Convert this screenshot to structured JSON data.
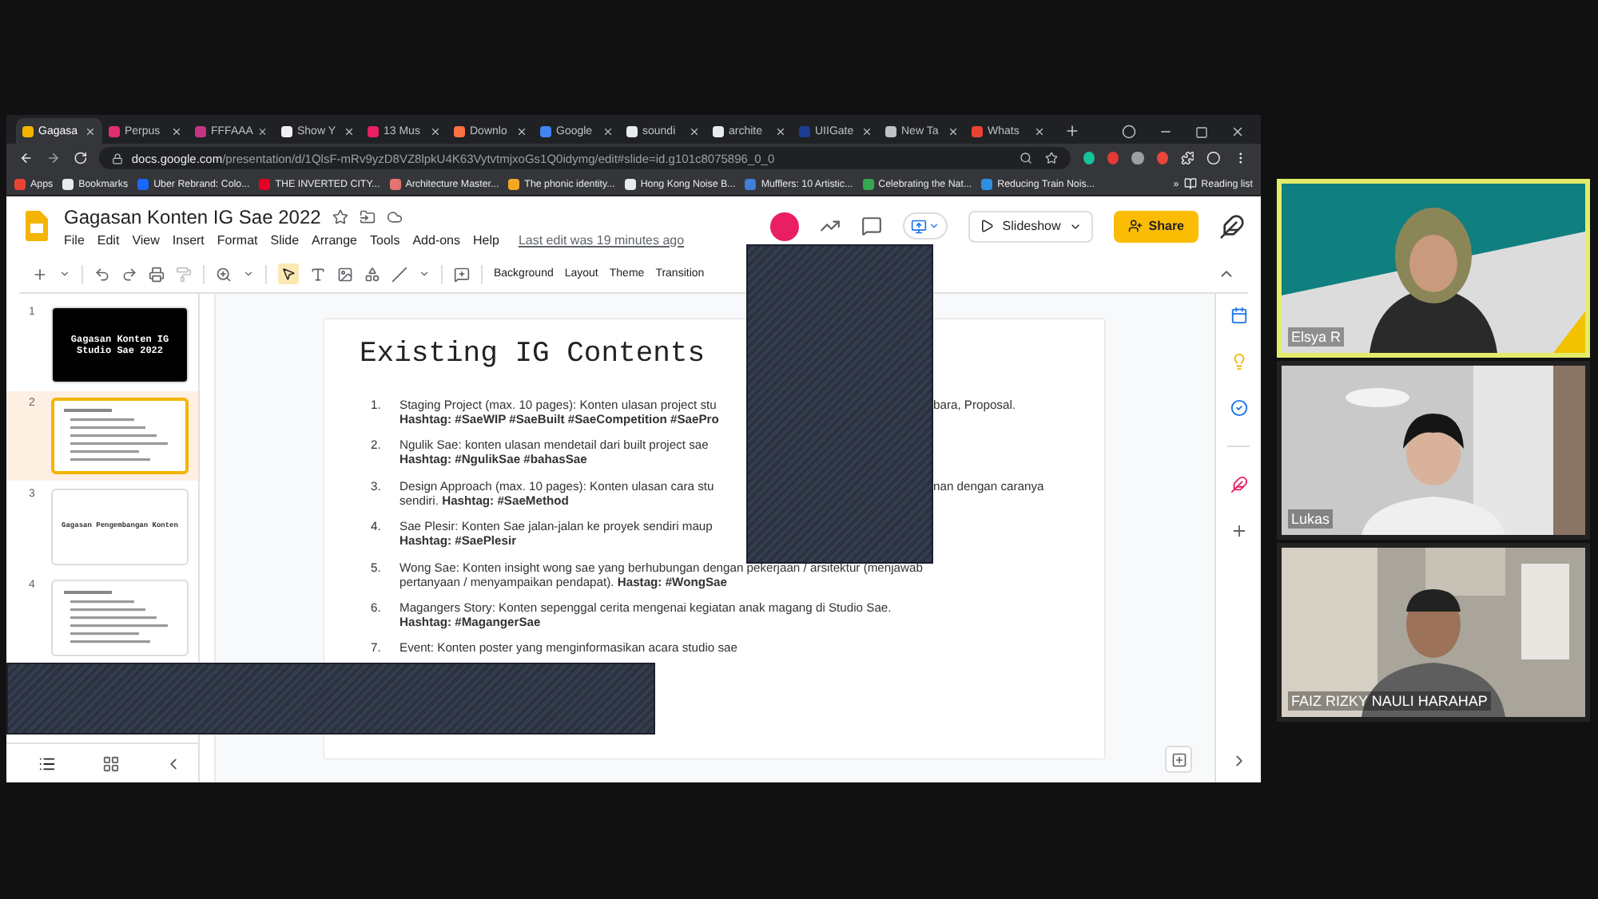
{
  "browser": {
    "tabs": [
      {
        "label": "Gagasa",
        "color": "#f4b400",
        "selected": true
      },
      {
        "label": "Perpus",
        "color": "#e1306c",
        "selected": false
      },
      {
        "label": "FFFAAA",
        "color": "#c13584",
        "selected": false
      },
      {
        "label": "Show Y",
        "color": "#f1f1f1",
        "selected": false
      },
      {
        "label": "13 Mus",
        "color": "#e91e63",
        "selected": false
      },
      {
        "label": "Downlo",
        "color": "#ff7043",
        "selected": false
      },
      {
        "label": "Google",
        "color": "#4285f4",
        "selected": false
      },
      {
        "label": "soundi",
        "color": "#e8eaed",
        "selected": false
      },
      {
        "label": "archite",
        "color": "#e8eaed",
        "selected": false
      },
      {
        "label": "UIIGate",
        "color": "#1a3d8f",
        "selected": false
      },
      {
        "label": "New Ta",
        "color": "#bdc1c6",
        "selected": false
      },
      {
        "label": "Whats",
        "color": "#ea4335",
        "selected": false
      }
    ],
    "url": {
      "host": "docs.google.com",
      "path": "/presentation/d/1QlsF-mRv9yzD8VZ8lpkU4K63VytvtmjxoGs1Q0idymg/edit#slide=id.g101c8075896_0_0"
    },
    "bookmarks": [
      {
        "label": "Apps",
        "color": "#ea4335"
      },
      {
        "label": "Bookmarks",
        "color": "#e8eaed"
      },
      {
        "label": "Uber Rebrand: Colo...",
        "color": "#1769ff"
      },
      {
        "label": "THE INVERTED CITY...",
        "color": "#e60023"
      },
      {
        "label": "Architecture Master...",
        "color": "#e57373"
      },
      {
        "label": "The phonic identity...",
        "color": "#f5a623"
      },
      {
        "label": "Hong Kong Noise B...",
        "color": "#e8eaed"
      },
      {
        "label": "Mufflers: 10 Artistic...",
        "color": "#3f7fd8"
      },
      {
        "label": "Celebrating the Nat...",
        "color": "#34a853"
      },
      {
        "label": "Reducing Train Nois...",
        "color": "#2d8fe0"
      }
    ],
    "more": "»",
    "reading_list": "Reading list"
  },
  "slides": {
    "title": "Gagasan Konten IG Sae 2022",
    "menu": [
      "File",
      "Edit",
      "View",
      "Insert",
      "Format",
      "Slide",
      "Arrange",
      "Tools",
      "Add-ons",
      "Help"
    ],
    "last_edit": "Last edit was 19 minutes ago",
    "slideshow": "Slideshow",
    "share": "Share",
    "toolbar": [
      "Background",
      "Layout",
      "Theme",
      "Transition"
    ],
    "thumbnails": [
      {
        "number": "1",
        "kind": "title-dark",
        "lines": [
          "Gagasan Konten IG",
          "Studio Sae 2022"
        ],
        "selected": false
      },
      {
        "number": "2",
        "kind": "bullets",
        "selected": true
      },
      {
        "number": "3",
        "kind": "title-light",
        "lines": [
          "Gagasan Pengembangan Konten"
        ],
        "selected": false
      },
      {
        "number": "4",
        "kind": "bullets",
        "selected": false
      }
    ],
    "slide": {
      "title": "Existing IG Contents",
      "items": [
        {
          "number": "1.",
          "lines": [
            {
              "left": "Staging Project (max. 10 pages): Konten ulasan project stu",
              "right": "bara, Proposal."
            },
            {
              "left": "**Hashtag: #SaeWIP #SaeBuilt #SaeCompetition #SaePro**"
            }
          ]
        },
        {
          "number": "2.",
          "lines": [
            {
              "left": "Ngulik Sae: konten ulasan mendetail dari built project sae"
            },
            {
              "left": "**Hashtag: #NgulikSae #bahasSae**"
            }
          ]
        },
        {
          "number": "3.",
          "lines": [
            {
              "left": "Design Approach (max. 10 pages): Konten ulasan cara stu",
              "right": "nan dengan caranya"
            },
            {
              "text": "sendiri. **Hashtag: #SaeMethod**"
            }
          ]
        },
        {
          "number": "4.",
          "lines": [
            {
              "left": "Sae Plesir: Konten Sae jalan-jalan ke proyek sendiri maup"
            },
            {
              "text": "**Hashtag: #SaePlesir**"
            }
          ]
        },
        {
          "number": "5.",
          "lines": [
            {
              "text": "Wong Sae: Konten insight wong sae yang berhubungan dengan pekerjaan / arsitektur (menjawab"
            },
            {
              "text": "pertanyaan / menyampaikan pendapat). **Hastag: #WongSae**"
            }
          ]
        },
        {
          "number": "6.",
          "lines": [
            {
              "text": "Magangers Story: Konten sepenggal cerita mengenai kegiatan anak magang di Studio Sae."
            },
            {
              "text": "**Hashtag: #MagangerSae**"
            }
          ]
        },
        {
          "number": "7.",
          "lines": [
            {
              "text": "Event: Konten poster yang menginformasikan acara  studio sae"
            }
          ]
        }
      ]
    }
  },
  "call": {
    "tiles": [
      {
        "name": "Elsya R",
        "speaking": true
      },
      {
        "name": "Lukas",
        "speaking": false
      },
      {
        "name": "FAIZ RIZKY NAULI HARAHAP",
        "speaking": false
      }
    ]
  }
}
